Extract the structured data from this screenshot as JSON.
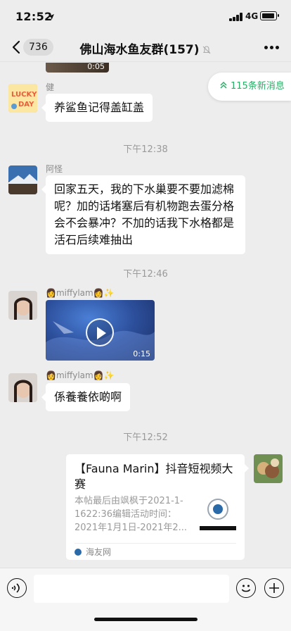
{
  "status_bar": {
    "time": "12:52",
    "network": "4G"
  },
  "nav": {
    "unread_count": "736",
    "title": "佛山海水鱼友群(157)"
  },
  "new_messages": {
    "label": "115条新消息"
  },
  "top_video": {
    "duration": "0:05"
  },
  "messages": [
    {
      "sender": "健",
      "text": "养鲨鱼记得盖缸盖"
    },
    {
      "sender": "阿怪",
      "text": "回家五天，我的下水巢要不要加滤棉呢？加的话堵塞后有机物跑去蛋分格会不会暴冲？不加的话我下水格都是活石后续难抽出"
    },
    {
      "sender": "👩miffylam👩✨",
      "video_duration": "0:15"
    },
    {
      "sender": "👩miffylam👩✨",
      "text": "係養養依啲啊"
    }
  ],
  "timestamps": [
    "下午12:38",
    "下午12:46",
    "下午12:52"
  ],
  "link_card": {
    "title": "【Fauna Marin】抖音短视频大赛",
    "description": "本帖最后由飒枫于2021-1-1622:36编辑活动时间：2021年1月1日-2021年2...",
    "source": "海友网"
  },
  "input": {
    "placeholder": ""
  },
  "colors": {
    "background": "#ededed",
    "accent_green": "#2aae67",
    "bubble": "#ffffff"
  }
}
